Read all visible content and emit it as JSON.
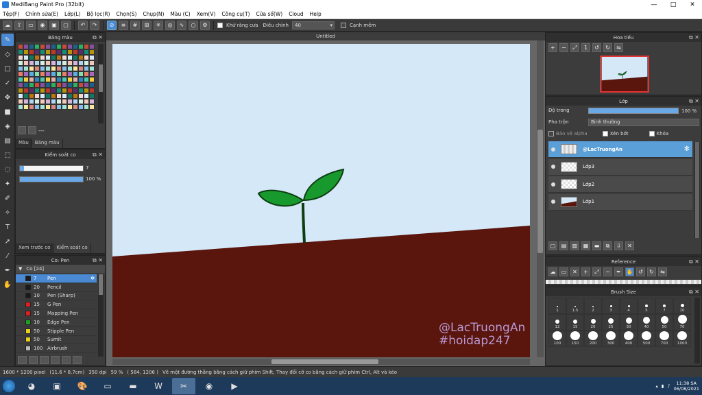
{
  "window": {
    "title": "MediBang Paint Pro (32bit)",
    "controls": [
      "—",
      "□",
      "✕"
    ]
  },
  "menu": [
    "Tệp(F)",
    "Chỉnh sửa(E)",
    "Lớp(L)",
    "Bộ lọc(R)",
    "Chọn(S)",
    "Chụp(N)",
    "Màu (C)",
    "Xem(V)",
    "Công cụ(T)",
    "Cửa sổ(W)",
    "Cloud",
    "Help"
  ],
  "toolbar": {
    "antialias_label": "Khử răng cưa",
    "correction_label": "Điều chỉnh",
    "correction_value": "40",
    "smooth_label": "Cạnh mềm"
  },
  "color_panel": {
    "title": "Bảng màu",
    "extra": "---",
    "tabs": [
      "Màu",
      "Bảng màu"
    ]
  },
  "brush_control": {
    "title": "Kiểm soát co",
    "size_value": "7",
    "opacity_value": "100 %",
    "opacity_fraction": 1.0,
    "tabs": [
      "Xem trước co",
      "Kiểm soát co"
    ]
  },
  "brush_panel": {
    "title": "Co: Pen",
    "group": "Co [24]",
    "items": [
      {
        "size": "7",
        "name": "Pen",
        "color": "#1a1a1a",
        "selected": true
      },
      {
        "size": "20",
        "name": "Pencil",
        "color": "#1a1a1a",
        "selected": false
      },
      {
        "size": "10",
        "name": "Pen (Sharp)",
        "color": "#1a1a1a",
        "selected": false
      },
      {
        "size": "15",
        "name": "G Pen",
        "color": "#e02020",
        "selected": false
      },
      {
        "size": "15",
        "name": "Mapping Pen",
        "color": "#e02020",
        "selected": false
      },
      {
        "size": "10",
        "name": "Edge Pen",
        "color": "#20a020",
        "selected": false
      },
      {
        "size": "50",
        "name": "Stipple Pen",
        "color": "#e8d020",
        "selected": false
      },
      {
        "size": "50",
        "name": "Sumit",
        "color": "#e8d020",
        "selected": false
      },
      {
        "size": "100",
        "name": "Airbrush",
        "color": "#bbbbbb",
        "selected": false
      }
    ]
  },
  "canvas": {
    "tab_title": "Untitled",
    "sky_color": "#d4e8f8",
    "ground_color": "#5a150c",
    "watermark_line1": "@LacTruongAn",
    "watermark_line2": "#hoidap247"
  },
  "navigator": {
    "title": "Hoa tiếu"
  },
  "layers": {
    "title": "Lớp",
    "opacity_label": "Độ trong",
    "opacity_value": "100 %",
    "blend_label": "Pha trộn",
    "blend_value": "Bình thường",
    "protect_alpha": "Bảo vệ alpha",
    "clipping": "Xén bớt",
    "lock": "Khóa",
    "items": [
      {
        "name": "@LacTruongAn",
        "selected": true
      },
      {
        "name": "Lớp3",
        "selected": false
      },
      {
        "name": "Lớp2",
        "selected": false
      },
      {
        "name": "Lớp1",
        "selected": false
      }
    ]
  },
  "reference": {
    "title": "Reference"
  },
  "brush_size": {
    "title": "Brush Size",
    "sizes": [
      "1",
      "1.5",
      "2",
      "3",
      "4",
      "5",
      "7",
      "10",
      "12",
      "15",
      "20",
      "25",
      "30",
      "40",
      "50",
      "70",
      "100",
      "150",
      "200",
      "300",
      "400",
      "500",
      "700",
      "1000"
    ]
  },
  "status": {
    "dimensions": "1600 * 1200 pixel",
    "physical": "(11.6 * 8.7cm)",
    "dpi": "350 dpi",
    "zoom": "59 %",
    "cursor": "( 584, 1206 )",
    "hint": "Vẽ một đường thẳng bằng cách giữ phím Shift, Thay đổi cỡ co bằng cách giữ phím Ctrl, Alt và kéo"
  },
  "taskbar": {
    "time": "11:38 SA",
    "date": "06/08/2021"
  }
}
